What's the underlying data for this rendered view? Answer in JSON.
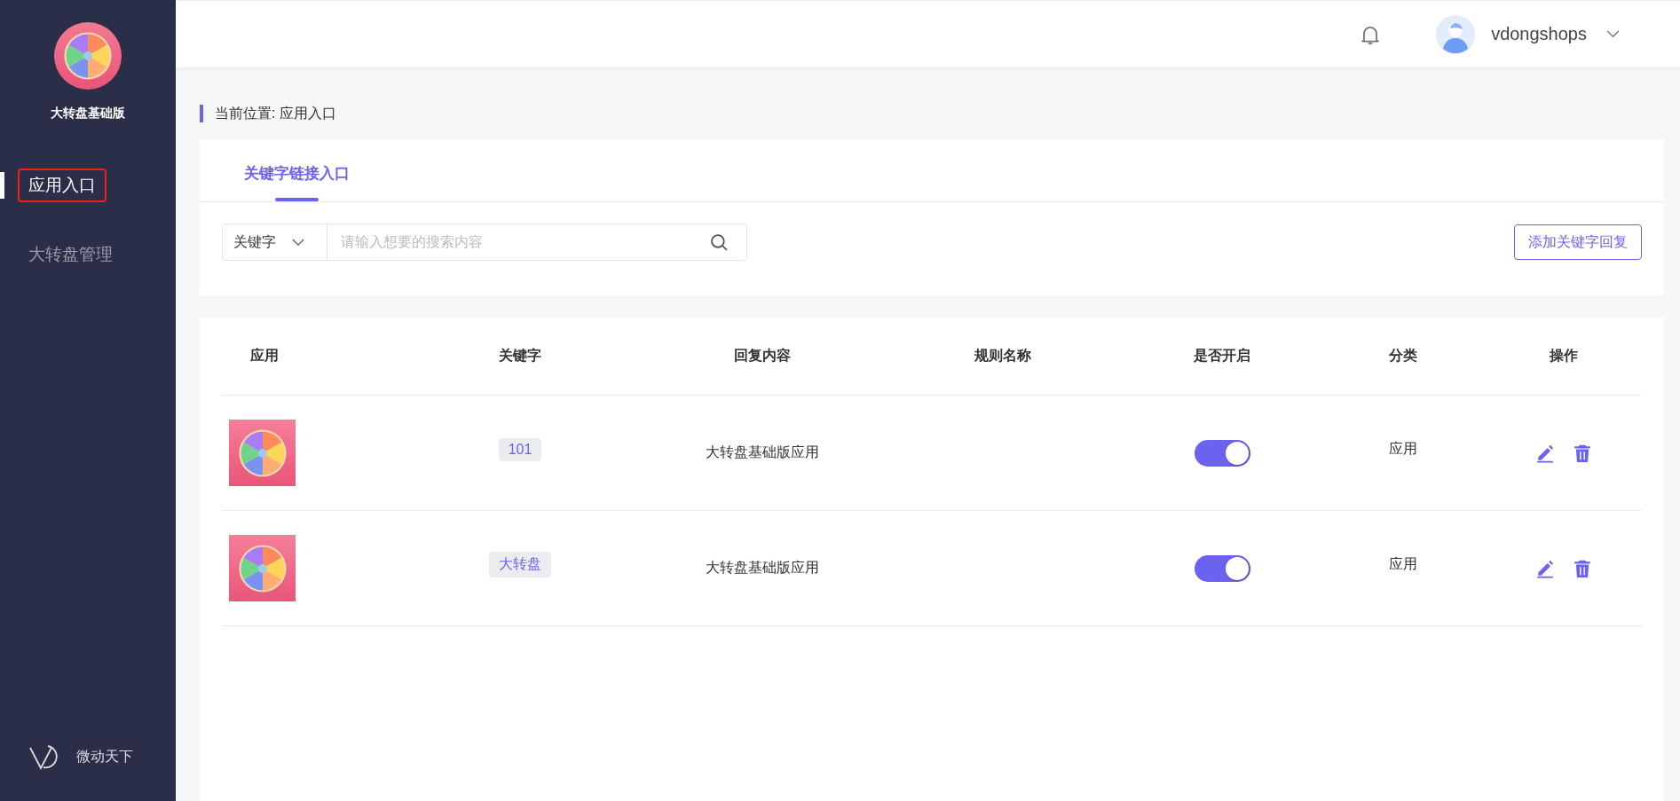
{
  "sidebar": {
    "app_name": "大转盘基础版",
    "items": [
      {
        "label": "应用入口",
        "selected": true
      },
      {
        "label": "大转盘管理",
        "selected": false
      }
    ],
    "footer_brand": "微动天下"
  },
  "header": {
    "username": "vdongshops"
  },
  "breadcrumb": {
    "label": "当前位置:",
    "current": "应用入口"
  },
  "tabs": [
    {
      "label": "关键字链接入口",
      "selected": true
    }
  ],
  "search": {
    "filter": "关键字",
    "placeholder": "请输入想要的搜索内容"
  },
  "add_button": "添加关键字回复",
  "table": {
    "columns": [
      "应用",
      "关键字",
      "回复内容",
      "规则名称",
      "是否开启",
      "分类",
      "操作"
    ],
    "rows": [
      {
        "keyword": "101",
        "reply": "大转盘基础版应用",
        "on": true,
        "category": "应用"
      },
      {
        "keyword": "大转盘",
        "reply": "大转盘基础版应用",
        "on": true,
        "category": "应用"
      }
    ]
  }
}
